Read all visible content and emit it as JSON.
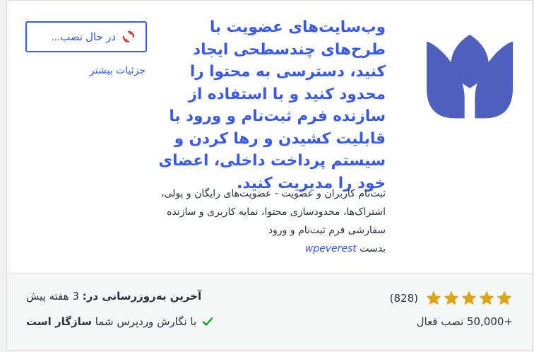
{
  "plugin": {
    "title": "وب‌سایت‌های عضویت با طرح‌های چندسطحی ایجاد کنید، دسترسی به محتوا را محدود کنید و با استفاده از سازنده فرم ثبت‌نام و ورود با قابلیت کشیدن و رها کردن و سیستم پرداخت داخلی، اعضای خود را مدیریت کنید.",
    "description": "ثبت‌نام کاربران و عضویت - عضویت‌های رایگان و پولی، اشتراک‌ها، محدودسازی محتوا، نمایه کاربری و سازنده سفارشی فرم ثبت‌نام و ورود",
    "by_prefix": "بدست",
    "author": "wpeverest",
    "logo_icon": "user-registration-logo-icon",
    "logo_color": "#4f5fbd"
  },
  "actions": {
    "install_label": "در حال نصب...",
    "more_details_label": "جزئیات بیشتر",
    "install_icon": "sync-icon",
    "install_icon_color": "#d63638"
  },
  "footer": {
    "rating_stars": 5,
    "rating_max": 5,
    "rating_count": "(828)",
    "active_installs": "+50,000 نصب فعال",
    "last_updated_label": "آخرین به‌روزرسانی در:",
    "last_updated_value": "3 هفته پیش",
    "compat_prefix": "با نگارش وردپرس شما",
    "compat_status": "سازگار است",
    "star_color": "#dba617",
    "check_color": "#00a32a"
  },
  "colors": {
    "accent": "#3858e9",
    "text": "#2c3338"
  }
}
